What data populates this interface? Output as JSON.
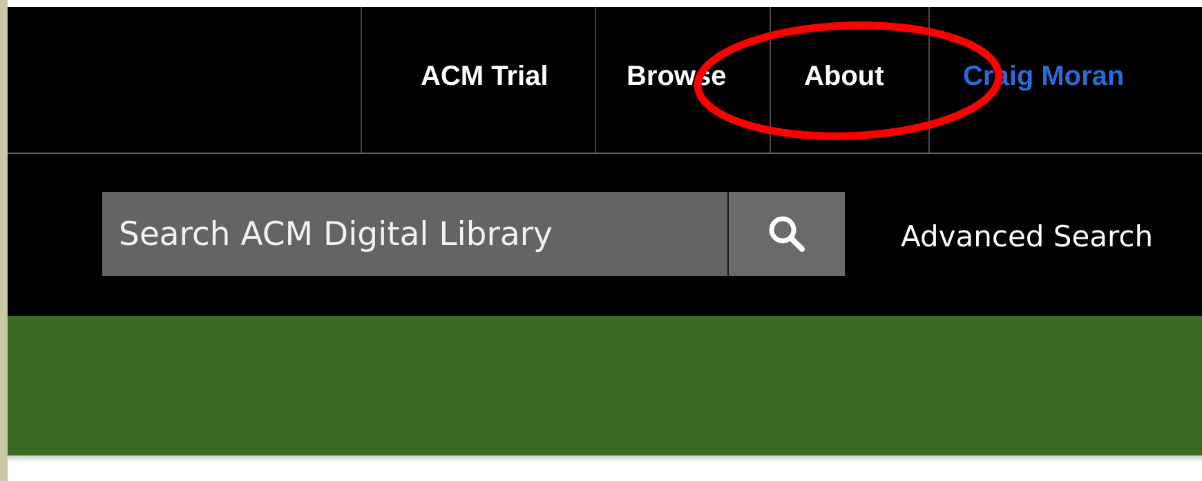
{
  "nav": {
    "items": [
      {
        "label": "ACM Trial"
      },
      {
        "label": "Browse"
      },
      {
        "label": "About"
      }
    ],
    "user_name": "Craig Moran"
  },
  "search": {
    "placeholder": "Search ACM Digital Library",
    "icon": "search-icon",
    "advanced_label": "Advanced Search"
  },
  "colors": {
    "header_bg": "#000000",
    "search_bg": "#646464",
    "user_link": "#2a6bd6",
    "banner_green": "#3a6a22",
    "annotation_red": "#ff0000"
  }
}
